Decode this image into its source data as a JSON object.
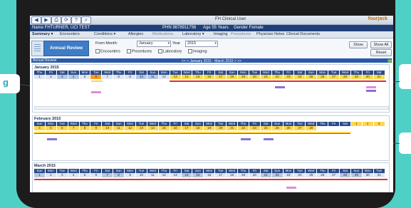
{
  "titlebar": {
    "app_title": "FH Clinical User",
    "logo_text": "fourjack"
  },
  "patient": {
    "name": "Name FHTURNER, UCI TEST",
    "phn": "PHN 9878911756",
    "age": "Age 55 Years",
    "gender": "Gender Female"
  },
  "menu": {
    "items": [
      "Summary ▾",
      "Encounters",
      "Conditions ▾",
      "Allergies",
      "Medications",
      "Laboratory ▾",
      "Imaging",
      "Procedures",
      "Physician Notes",
      "Clinical Documents"
    ]
  },
  "toolbar": {
    "title": "Annual Review",
    "from_label": "From Month:",
    "month_value": "January",
    "year_label": "Year",
    "year_value": "2015",
    "filters": [
      "Encounters",
      "Procedures",
      "Laboratory",
      "Imaging"
    ],
    "show_label": "Show",
    "show_all_label": "Show All",
    "reset_label": "Reset"
  },
  "section": {
    "title": "Annual Review",
    "range_label": "<< < January 2015 - March 2015 > >>"
  },
  "months": [
    {
      "title": "January 2015",
      "weekdays": [
        "Thu",
        "Fri",
        "Sat",
        "Sun",
        "Mon",
        "Tue",
        "Wed",
        "Thu",
        "Fri",
        "Sat",
        "Sun",
        "Mon",
        "Tue",
        "Wed",
        "Thu",
        "Fri",
        "Sat",
        "Sun",
        "Mon",
        "Tue",
        "Wed",
        "Thu",
        "Fri",
        "Sat",
        "Sun",
        "Mon",
        "Tue",
        "Wed",
        "Thu",
        "Fri",
        "Sat"
      ],
      "days": [
        "1",
        "2",
        "3",
        "4",
        "5",
        "6",
        "7",
        "8",
        "9",
        "10",
        "11",
        "12",
        "13",
        "14",
        "15",
        "16",
        "17",
        "18",
        "19",
        "20",
        "21",
        "22",
        "23",
        "24",
        "25",
        "26",
        "27",
        "28",
        "29",
        "30",
        "31"
      ]
    },
    {
      "title": "February 2015",
      "weekdays": [
        "Sun",
        "Mon",
        "Tue",
        "Wed",
        "Thu",
        "Fri",
        "Sat",
        "Sun",
        "Mon",
        "Tue",
        "Wed",
        "Thu",
        "Fri",
        "Sat",
        "Sun",
        "Mon",
        "Tue",
        "Wed",
        "Thu",
        "Fri",
        "Sat",
        "Sun",
        "Mon",
        "Tue",
        "Wed",
        "Thu",
        "Fri",
        "Sat"
      ],
      "days": [
        "1",
        "2",
        "3",
        "4",
        "5",
        "6",
        "7",
        "8",
        "9",
        "10",
        "11",
        "12",
        "13",
        "14",
        "15",
        "16",
        "17",
        "18",
        "19",
        "20",
        "21",
        "22",
        "23",
        "24",
        "25",
        "26",
        "27",
        "28"
      ]
    },
    {
      "title": "March 2015",
      "weekdays": [
        "Sun",
        "Mon",
        "Tue",
        "Wed",
        "Thu",
        "Fri",
        "Sat",
        "Sun",
        "Mon",
        "Tue",
        "Wed",
        "Thu",
        "Fri",
        "Sat",
        "Sun",
        "Mon",
        "Tue",
        "Wed",
        "Thu",
        "Fri",
        "Sat",
        "Sun",
        "Mon",
        "Tue",
        "Wed",
        "Thu",
        "Fri",
        "Sat",
        "Sun",
        "Mon",
        "Tue"
      ],
      "days": [
        "1",
        "2",
        "3",
        "4",
        "5",
        "6",
        "7",
        "8",
        "9",
        "10",
        "11",
        "12",
        "13",
        "14",
        "15",
        "16",
        "17",
        "18",
        "19",
        "20",
        "21",
        "22",
        "23",
        "24",
        "25",
        "26",
        "27",
        "28",
        "29",
        "30",
        "31"
      ]
    }
  ],
  "colors": {
    "accent": "#2a4c8c",
    "highlight": "#ffd84a",
    "today": "#ff9c1f",
    "event_purple": "#8b6fd6",
    "event_pink": "#e38bd6",
    "bar_red": "#e03030",
    "background": "#4fd0c7"
  },
  "callout_left_text": "g"
}
